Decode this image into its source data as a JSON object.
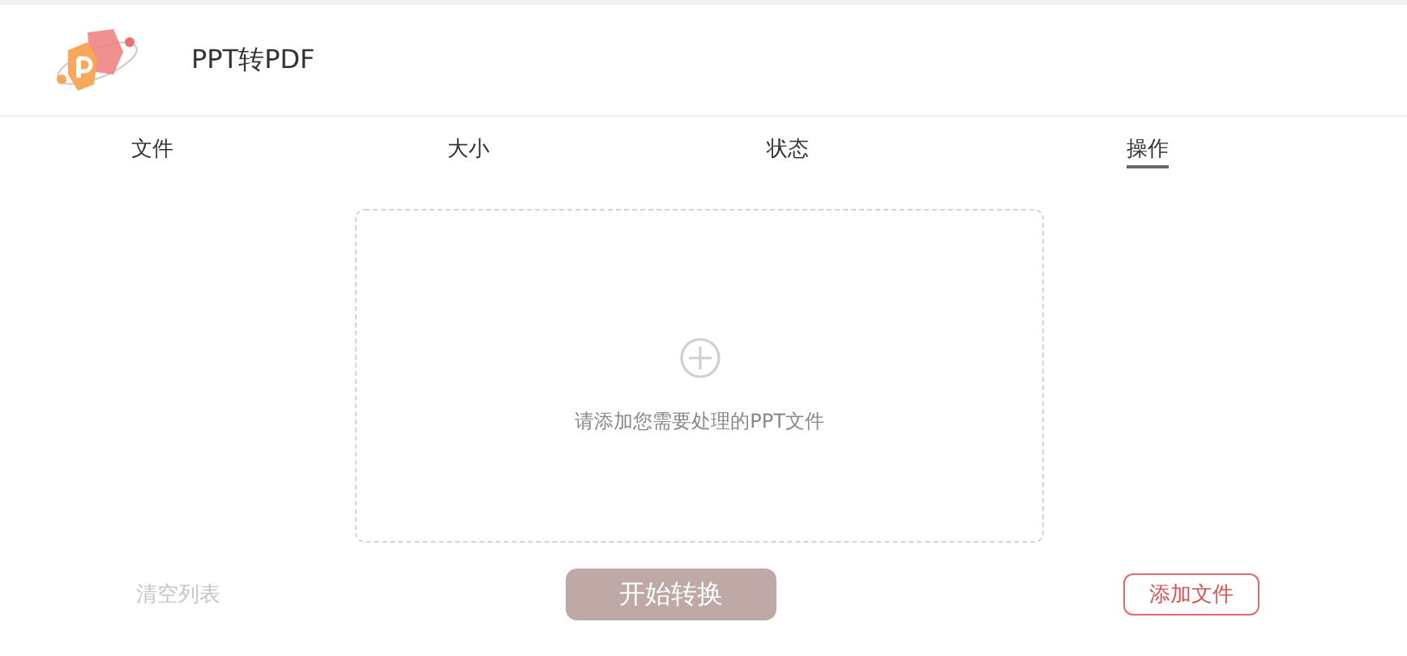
{
  "header": {
    "title": "PPT转PDF"
  },
  "columns": [
    {
      "label": "文件",
      "selected": false
    },
    {
      "label": "大小",
      "selected": false
    },
    {
      "label": "状态",
      "selected": false
    },
    {
      "label": "操作",
      "selected": true
    }
  ],
  "drop_area": {
    "hint": "请添加您需要处理的PPT文件"
  },
  "clear_button": {
    "label": "清空列表",
    "disabled": true
  },
  "start_button": {
    "label": "开始转换",
    "disabled": true
  },
  "add_button": {
    "label": "添加文件",
    "disabled": false
  }
}
